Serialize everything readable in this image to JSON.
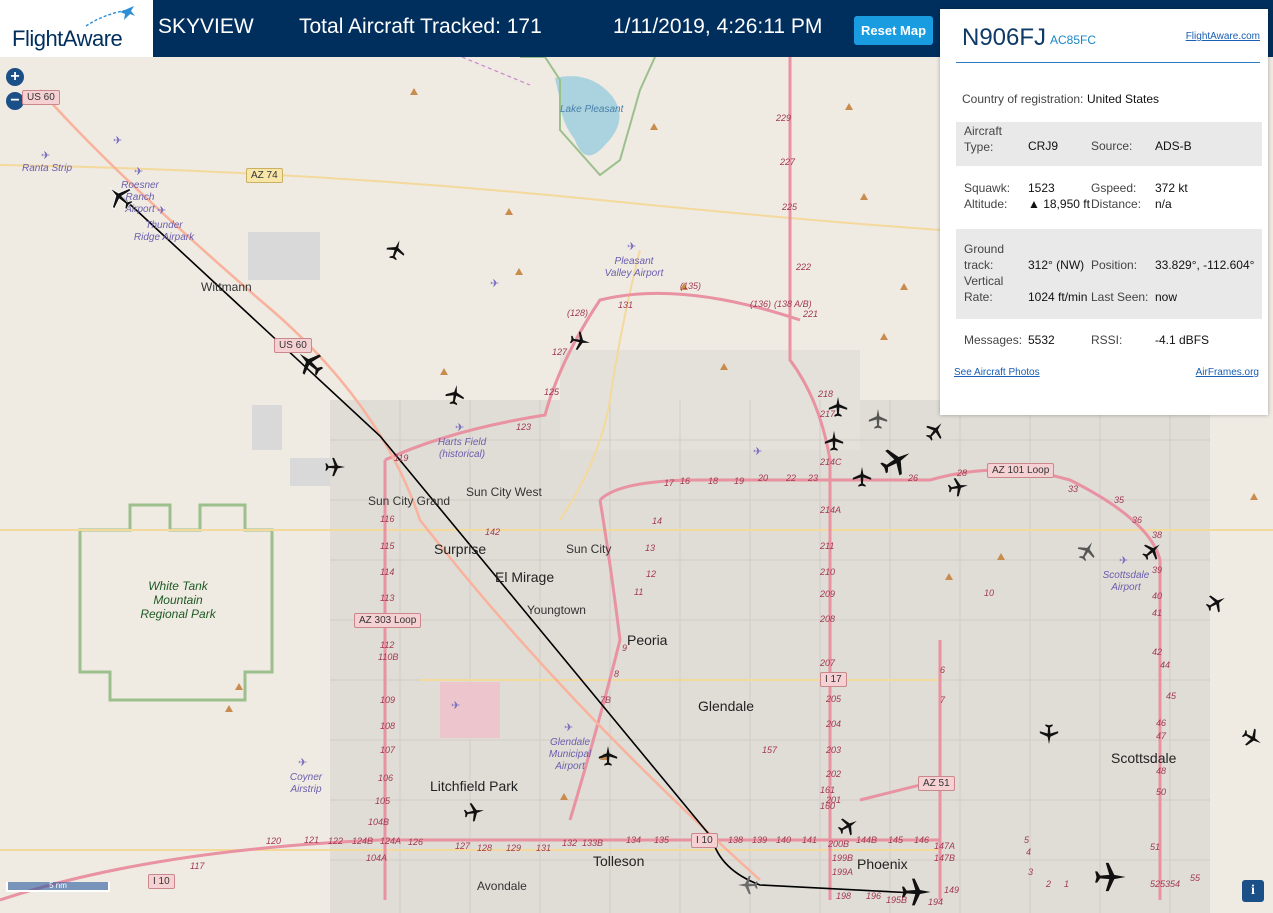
{
  "header": {
    "logo_text": "FlightAware",
    "app_name": "SKYVIEW",
    "tracked_text": "Total Aircraft Tracked: 171",
    "datetime": "1/11/2019, 4:26:11 PM",
    "reset_label": "Reset Map"
  },
  "map": {
    "zoom_in": "+",
    "zoom_out": "−",
    "scale_label": "5 nm",
    "info_label": "i",
    "cities": [
      {
        "name": "Wittmann",
        "size": "sm"
      },
      {
        "name": "Sun City Grand",
        "size": "sm"
      },
      {
        "name": "Sun City West",
        "size": "sm"
      },
      {
        "name": "Surprise",
        "size": "lg"
      },
      {
        "name": "Sun City",
        "size": "sm"
      },
      {
        "name": "El Mirage",
        "size": "lg"
      },
      {
        "name": "Youngtown",
        "size": "sm"
      },
      {
        "name": "Peoria",
        "size": "lg"
      },
      {
        "name": "Glendale",
        "size": "lg"
      },
      {
        "name": "Litchfield Park",
        "size": "lg"
      },
      {
        "name": "Tolleson",
        "size": "lg"
      },
      {
        "name": "Avondale",
        "size": "sm"
      },
      {
        "name": "Phoenix",
        "size": "lg"
      },
      {
        "name": "Scottsdale",
        "size": "lg"
      }
    ],
    "airports": [
      "Ranta Strip",
      "Roesner Ranch Airport",
      "Thunder Ridge Airpark",
      "Pleasant Valley Airport",
      "Harts Field (historical)",
      "Glendale Municipal Airport",
      "Coyner Airstrip",
      "Scottsdale Airport"
    ],
    "parks": [
      "White Tank Mountain Regional Park"
    ],
    "water": [
      "Lake Pleasant"
    ],
    "shields": [
      "US 60",
      "AZ 74",
      "US 60",
      "AZ 101 Loop",
      "AZ 303 Loop",
      "I 17",
      "AZ 51",
      "I 10",
      "I 10"
    ],
    "exits": [
      "229",
      "227",
      "225",
      "222",
      "221",
      "218",
      "217",
      "214C",
      "214A",
      "211",
      "210",
      "209",
      "208",
      "207",
      "205",
      "204",
      "203",
      "202",
      "201",
      "200B",
      "199B",
      "199A",
      "198",
      "196",
      "195B",
      "194",
      "119",
      "116",
      "115",
      "114",
      "113",
      "112",
      "110B",
      "109",
      "108",
      "107",
      "106",
      "105",
      "104B",
      "104A",
      "124A",
      "124B",
      "126",
      "127",
      "128",
      "129",
      "131",
      "132",
      "133B",
      "134",
      "135",
      "138",
      "139",
      "140",
      "141",
      "142",
      "144B",
      "145",
      "146",
      "147A",
      "147B",
      "149",
      "17",
      "16",
      "18",
      "19",
      "20",
      "22",
      "23",
      "26",
      "28",
      "33",
      "35",
      "36",
      "38",
      "39",
      "40",
      "41",
      "42",
      "44",
      "45",
      "46",
      "47",
      "48",
      "50",
      "51",
      "52",
      "53",
      "54",
      "55",
      "5",
      "4",
      "3",
      "2",
      "1",
      "14",
      "13",
      "12",
      "11",
      "10",
      "9",
      "8",
      "7",
      "6",
      "7B",
      "125",
      "123",
      "121",
      "122",
      "120",
      "117",
      "127",
      "(128)",
      "131",
      "(135)",
      "(136)",
      "(138 A/B)",
      "161",
      "160",
      "157"
    ]
  },
  "panel": {
    "registration": "N906FJ",
    "hex": "AC85FC",
    "fa_link": "FlightAware.com",
    "country_label": "Country of registration:",
    "country_value": "United States",
    "type_label": "Aircraft Type:",
    "type_value": "CRJ9",
    "source_label": "Source:",
    "source_value": "ADS-B",
    "squawk_label": "Squawk:",
    "squawk_value": "1523",
    "gspeed_label": "Gspeed:",
    "gspeed_value": "372 kt",
    "altitude_label": "Altitude:",
    "altitude_value": "▲ 18,950 ft",
    "distance_label": "Distance:",
    "distance_value": "n/a",
    "track_label": "Ground track:",
    "track_value": "312° (NW)",
    "position_label": "Position:",
    "position_value": "33.829°, -112.604°",
    "vrate_label": "Vertical Rate:",
    "vrate_value": "1024 ft/min",
    "lastseen_label": "Last Seen:",
    "lastseen_value": "now",
    "messages_label": "Messages:",
    "messages_value": "5532",
    "rssi_label": "RSSI:",
    "rssi_value": "-4.1 dBFS",
    "photos_link": "See Aircraft Photos",
    "airframes_link": "AirFrames.org"
  },
  "colors": {
    "header_bg": "#002f5d",
    "accent": "#1a9de0",
    "motorway": "#e892a2",
    "trunk": "#f9b29c",
    "track_line": "#000000",
    "park_border": "#9cc08c",
    "water": "#aad3df"
  }
}
